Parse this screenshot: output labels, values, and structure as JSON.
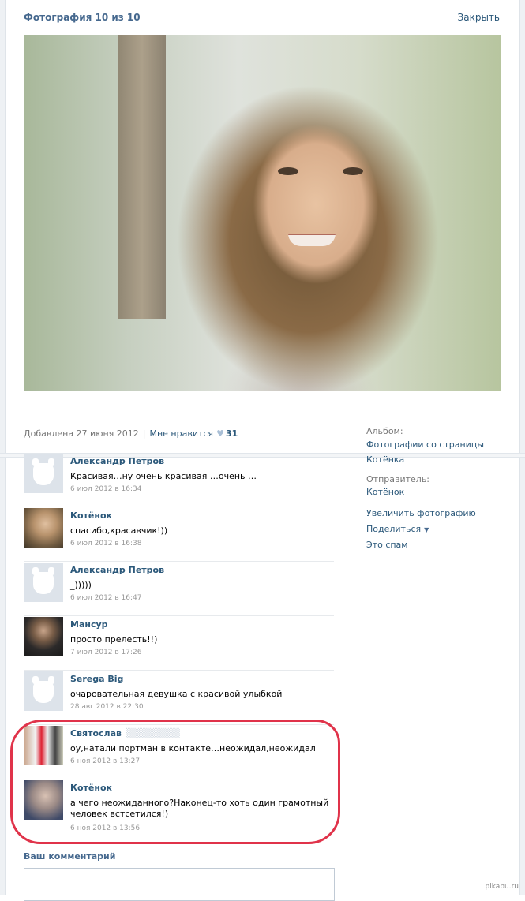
{
  "header": {
    "title": "Фотография 10 из 10",
    "close_label": "Закрыть"
  },
  "photo_info": {
    "added": "Добавлена 27 июня 2012",
    "like_label": "Мне нравится",
    "like_count": "31"
  },
  "sidebar": {
    "album_label": "Альбом:",
    "album_value_line1": "Фотографии со страницы",
    "album_value_line2": "Котёнка",
    "sender_label": "Отправитель:",
    "sender_value": "Котёнок",
    "actions": [
      "Увеличить фотографию",
      "Поделиться",
      "Это спам"
    ]
  },
  "comments": [
    {
      "author": "Александр Петров",
      "author_extra": "",
      "text": "Красивая…ну очень красивая …очень …",
      "date": "6 июл 2012 в 16:34",
      "avatar": "default"
    },
    {
      "author": "Котёнок",
      "author_extra": "",
      "text": "спасибо,красавчик!))",
      "date": "6 июл 2012 в 16:38",
      "avatar": "photo1"
    },
    {
      "author": "Александр Петров",
      "author_extra": "",
      "text": "_)))))",
      "date": "6 июл 2012 в 16:47",
      "avatar": "default"
    },
    {
      "author": "Мансур",
      "author_extra": "",
      "text": "просто прелесть!!)",
      "date": "7 июл 2012 в 17:26",
      "avatar": "photo2"
    },
    {
      "author": "Serega Big",
      "author_extra": "",
      "text": "очаровательная девушка с красивой улыбкой",
      "date": "28 авг 2012 в 22:30",
      "avatar": "default"
    },
    {
      "author": "Святослав",
      "author_extra": "",
      "text": "оу,натали портман в контакте…неожидал,неожидал",
      "date": "6 ноя 2012 в 13:27",
      "avatar": "photo3"
    },
    {
      "author": "Котёнок",
      "author_extra": "",
      "text": "а чего неожиданного?Наконец-то хоть один грамотный человек встсетился!)",
      "date": "6 ноя 2012 в 13:56",
      "avatar": "photo4"
    }
  ],
  "compose": {
    "label": "Ваш комментарий"
  },
  "watermark": "pikabu.ru",
  "colors": {
    "link": "#2b587a",
    "title": "#45688e",
    "highlight": "#e0334a"
  }
}
